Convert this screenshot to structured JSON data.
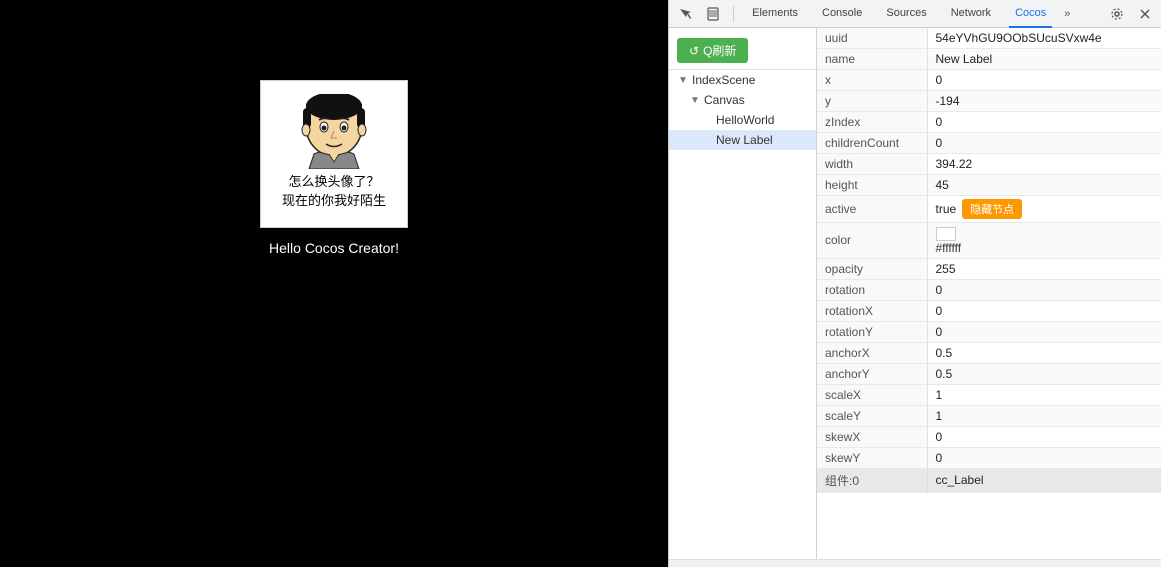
{
  "game": {
    "background_color": "#000000",
    "meme_text_line1": "怎么换头像了？",
    "meme_text_line2": "现在的你我好陌生",
    "hello_text": "Hello Cocos Creator!"
  },
  "devtools": {
    "tabs": [
      {
        "label": "Elements",
        "active": false
      },
      {
        "label": "Console",
        "active": false
      },
      {
        "label": "Sources",
        "active": false
      },
      {
        "label": "Network",
        "active": false
      },
      {
        "label": "Cocos",
        "active": true
      }
    ],
    "more_label": "»",
    "refresh_btn_label": "Q刷新",
    "scene_tree": [
      {
        "label": "IndexScene",
        "level": 0,
        "arrow": "▼"
      },
      {
        "label": "Canvas",
        "level": 1,
        "arrow": "▼"
      },
      {
        "label": "HelloWorld",
        "level": 2,
        "arrow": ""
      },
      {
        "label": "New Label",
        "level": 2,
        "arrow": ""
      }
    ],
    "properties": [
      {
        "key": "uuid",
        "value": "54eYVhGU9OObSUcuSVxw4e"
      },
      {
        "key": "name",
        "value": "New Label"
      },
      {
        "key": "x",
        "value": "0"
      },
      {
        "key": "y",
        "value": "-194"
      },
      {
        "key": "zIndex",
        "value": "0"
      },
      {
        "key": "childrenCount",
        "value": "0"
      },
      {
        "key": "width",
        "value": "394.22"
      },
      {
        "key": "height",
        "value": "45"
      },
      {
        "key": "active",
        "value": "true",
        "has_button": true,
        "button_label": "隐藏节点"
      },
      {
        "key": "color",
        "value": "",
        "is_color": true,
        "color_hex": "#ffffff"
      },
      {
        "key": "opacity",
        "value": "255"
      },
      {
        "key": "rotation",
        "value": "0"
      },
      {
        "key": "rotationX",
        "value": "0"
      },
      {
        "key": "rotationY",
        "value": "0"
      },
      {
        "key": "anchorX",
        "value": "0.5"
      },
      {
        "key": "anchorY",
        "value": "0.5"
      },
      {
        "key": "scaleX",
        "value": "1"
      },
      {
        "key": "scaleY",
        "value": "1"
      },
      {
        "key": "skewX",
        "value": "0"
      },
      {
        "key": "skewY",
        "value": "0"
      }
    ],
    "component": {
      "key": "组件:0",
      "value": "cc_Label"
    }
  }
}
